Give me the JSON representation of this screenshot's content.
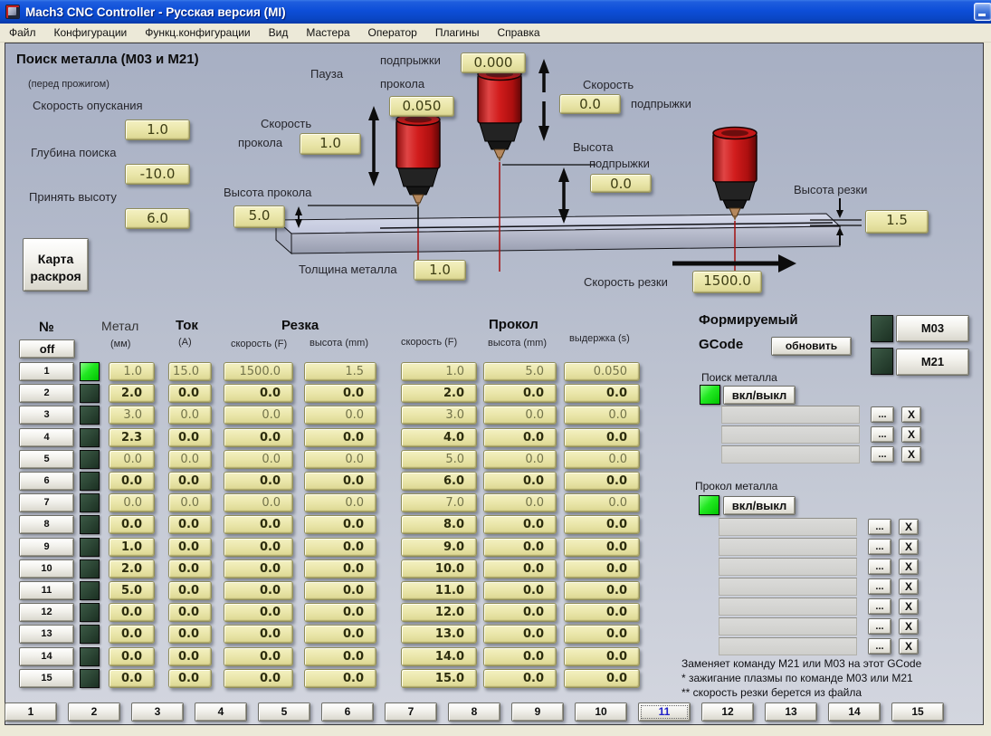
{
  "window": {
    "title": "Mach3 CNC Controller - Русская версия (MI)"
  },
  "menu": {
    "items": [
      "Файл",
      "Конфигурации",
      "Функц.конфигурации",
      "Вид",
      "Мастера",
      "Оператор",
      "Плагины",
      "Справка"
    ]
  },
  "search_panel": {
    "title": "Поиск металла (M03 и M21)",
    "subtitle": "(перед прожигом)",
    "descent_speed_label": "Скорость опускания",
    "descent_speed": "1.0",
    "search_depth_label": "Глубина поиска",
    "search_depth": "-10.0",
    "accept_height_label": "Принять высоту",
    "accept_height": "6.0",
    "cut_map_button": "Карта раскроя"
  },
  "diagram": {
    "pause_label": "Пауза",
    "jump_word": "подпрыжки",
    "pierce_word": "прокола",
    "pause_jump_value": "0.000",
    "pause_pierce_value": "0.050",
    "pierce_speed_label_1": "Скорость",
    "pierce_speed_label_2": "прокола",
    "pierce_speed": "1.0",
    "jump_speed_label_1": "Скорость",
    "jump_speed_label_2": "подпрыжки",
    "jump_speed": "0.0",
    "jump_height_label_1": "Высота",
    "jump_height_label_2": "подпрыжки",
    "jump_height": "0.0",
    "pierce_height_label": "Высота прокола",
    "pierce_height": "5.0",
    "cut_height_label": "Высота резки",
    "cut_height": "1.5",
    "metal_thickness_label": "Толщина металла",
    "metal_thickness": "1.0",
    "cut_speed_label": "Скорость резки",
    "cut_speed": "1500.0"
  },
  "table": {
    "num_header": "№",
    "off_button": "off",
    "metal_header": "Метал",
    "metal_sub": "(мм)",
    "current_header": "Ток",
    "current_sub": "(A)",
    "cut_group": "Резка",
    "cut_speed_sub": "скорость (F)",
    "cut_height_sub": "высота (mm)",
    "pierce_group": "Прокол",
    "pierce_speed_sub": "скорость (F)",
    "pierce_height_sub": "высота (mm)",
    "dwell_sub": "выдержка (s)",
    "rows": [
      {
        "num": "1",
        "led_on": true,
        "dim": true,
        "metal": "1.0",
        "current": "15.0",
        "cut_speed": "1500.0",
        "cut_height": "1.5",
        "pierce_speed": "1.0",
        "pierce_height": "5.0",
        "dwell": "0.050"
      },
      {
        "num": "2",
        "led_on": false,
        "dim": false,
        "metal": "2.0",
        "current": "0.0",
        "cut_speed": "0.0",
        "cut_height": "0.0",
        "pierce_speed": "2.0",
        "pierce_height": "0.0",
        "dwell": "0.0"
      },
      {
        "num": "3",
        "led_on": false,
        "dim": true,
        "metal": "3.0",
        "current": "0.0",
        "cut_speed": "0.0",
        "cut_height": "0.0",
        "pierce_speed": "3.0",
        "pierce_height": "0.0",
        "dwell": "0.0"
      },
      {
        "num": "4",
        "led_on": false,
        "dim": false,
        "metal": "2.3",
        "current": "0.0",
        "cut_speed": "0.0",
        "cut_height": "0.0",
        "pierce_speed": "4.0",
        "pierce_height": "0.0",
        "dwell": "0.0"
      },
      {
        "num": "5",
        "led_on": false,
        "dim": true,
        "metal": "0.0",
        "current": "0.0",
        "cut_speed": "0.0",
        "cut_height": "0.0",
        "pierce_speed": "5.0",
        "pierce_height": "0.0",
        "dwell": "0.0"
      },
      {
        "num": "6",
        "led_on": false,
        "dim": false,
        "metal": "0.0",
        "current": "0.0",
        "cut_speed": "0.0",
        "cut_height": "0.0",
        "pierce_speed": "6.0",
        "pierce_height": "0.0",
        "dwell": "0.0"
      },
      {
        "num": "7",
        "led_on": false,
        "dim": true,
        "metal": "0.0",
        "current": "0.0",
        "cut_speed": "0.0",
        "cut_height": "0.0",
        "pierce_speed": "7.0",
        "pierce_height": "0.0",
        "dwell": "0.0"
      },
      {
        "num": "8",
        "led_on": false,
        "dim": false,
        "metal": "0.0",
        "current": "0.0",
        "cut_speed": "0.0",
        "cut_height": "0.0",
        "pierce_speed": "8.0",
        "pierce_height": "0.0",
        "dwell": "0.0"
      },
      {
        "num": "9",
        "led_on": false,
        "dim": false,
        "metal": "1.0",
        "current": "0.0",
        "cut_speed": "0.0",
        "cut_height": "0.0",
        "pierce_speed": "9.0",
        "pierce_height": "0.0",
        "dwell": "0.0"
      },
      {
        "num": "10",
        "led_on": false,
        "dim": false,
        "metal": "2.0",
        "current": "0.0",
        "cut_speed": "0.0",
        "cut_height": "0.0",
        "pierce_speed": "10.0",
        "pierce_height": "0.0",
        "dwell": "0.0"
      },
      {
        "num": "11",
        "led_on": false,
        "dim": false,
        "metal": "5.0",
        "current": "0.0",
        "cut_speed": "0.0",
        "cut_height": "0.0",
        "pierce_speed": "11.0",
        "pierce_height": "0.0",
        "dwell": "0.0"
      },
      {
        "num": "12",
        "led_on": false,
        "dim": false,
        "metal": "0.0",
        "current": "0.0",
        "cut_speed": "0.0",
        "cut_height": "0.0",
        "pierce_speed": "12.0",
        "pierce_height": "0.0",
        "dwell": "0.0"
      },
      {
        "num": "13",
        "led_on": false,
        "dim": false,
        "metal": "0.0",
        "current": "0.0",
        "cut_speed": "0.0",
        "cut_height": "0.0",
        "pierce_speed": "13.0",
        "pierce_height": "0.0",
        "dwell": "0.0"
      },
      {
        "num": "14",
        "led_on": false,
        "dim": false,
        "metal": "0.0",
        "current": "0.0",
        "cut_speed": "0.0",
        "cut_height": "0.0",
        "pierce_speed": "14.0",
        "pierce_height": "0.0",
        "dwell": "0.0"
      },
      {
        "num": "15",
        "led_on": false,
        "dim": false,
        "metal": "0.0",
        "current": "0.0",
        "cut_speed": "0.0",
        "cut_height": "0.0",
        "pierce_speed": "15.0",
        "pierce_height": "0.0",
        "dwell": "0.0"
      }
    ]
  },
  "gcode_panel": {
    "title_line1": "Формируемый",
    "title_line2": "GCode",
    "refresh_button": "обновить",
    "m03_button": "M03",
    "m21_button": "M21",
    "search_section_label": "Поиск металла",
    "pierce_section_label": "Прокол металла",
    "toggle_button": "вкл/выкл",
    "browse_label": "...",
    "clear_label": "X",
    "search_slots": [
      "",
      "",
      ""
    ],
    "pierce_slots": [
      "",
      "",
      "",
      "",
      "",
      "",
      ""
    ],
    "notes": [
      "Заменяет команду M21 или M03 на этот GCode",
      "* зажигание плазмы по команде M03 или M21",
      "** скорость резки берется из файла"
    ]
  },
  "tabs": {
    "items": [
      "1",
      "2",
      "3",
      "4",
      "5",
      "6",
      "7",
      "8",
      "9",
      "10",
      "11",
      "12",
      "13",
      "14",
      "15"
    ],
    "active": "11"
  }
}
